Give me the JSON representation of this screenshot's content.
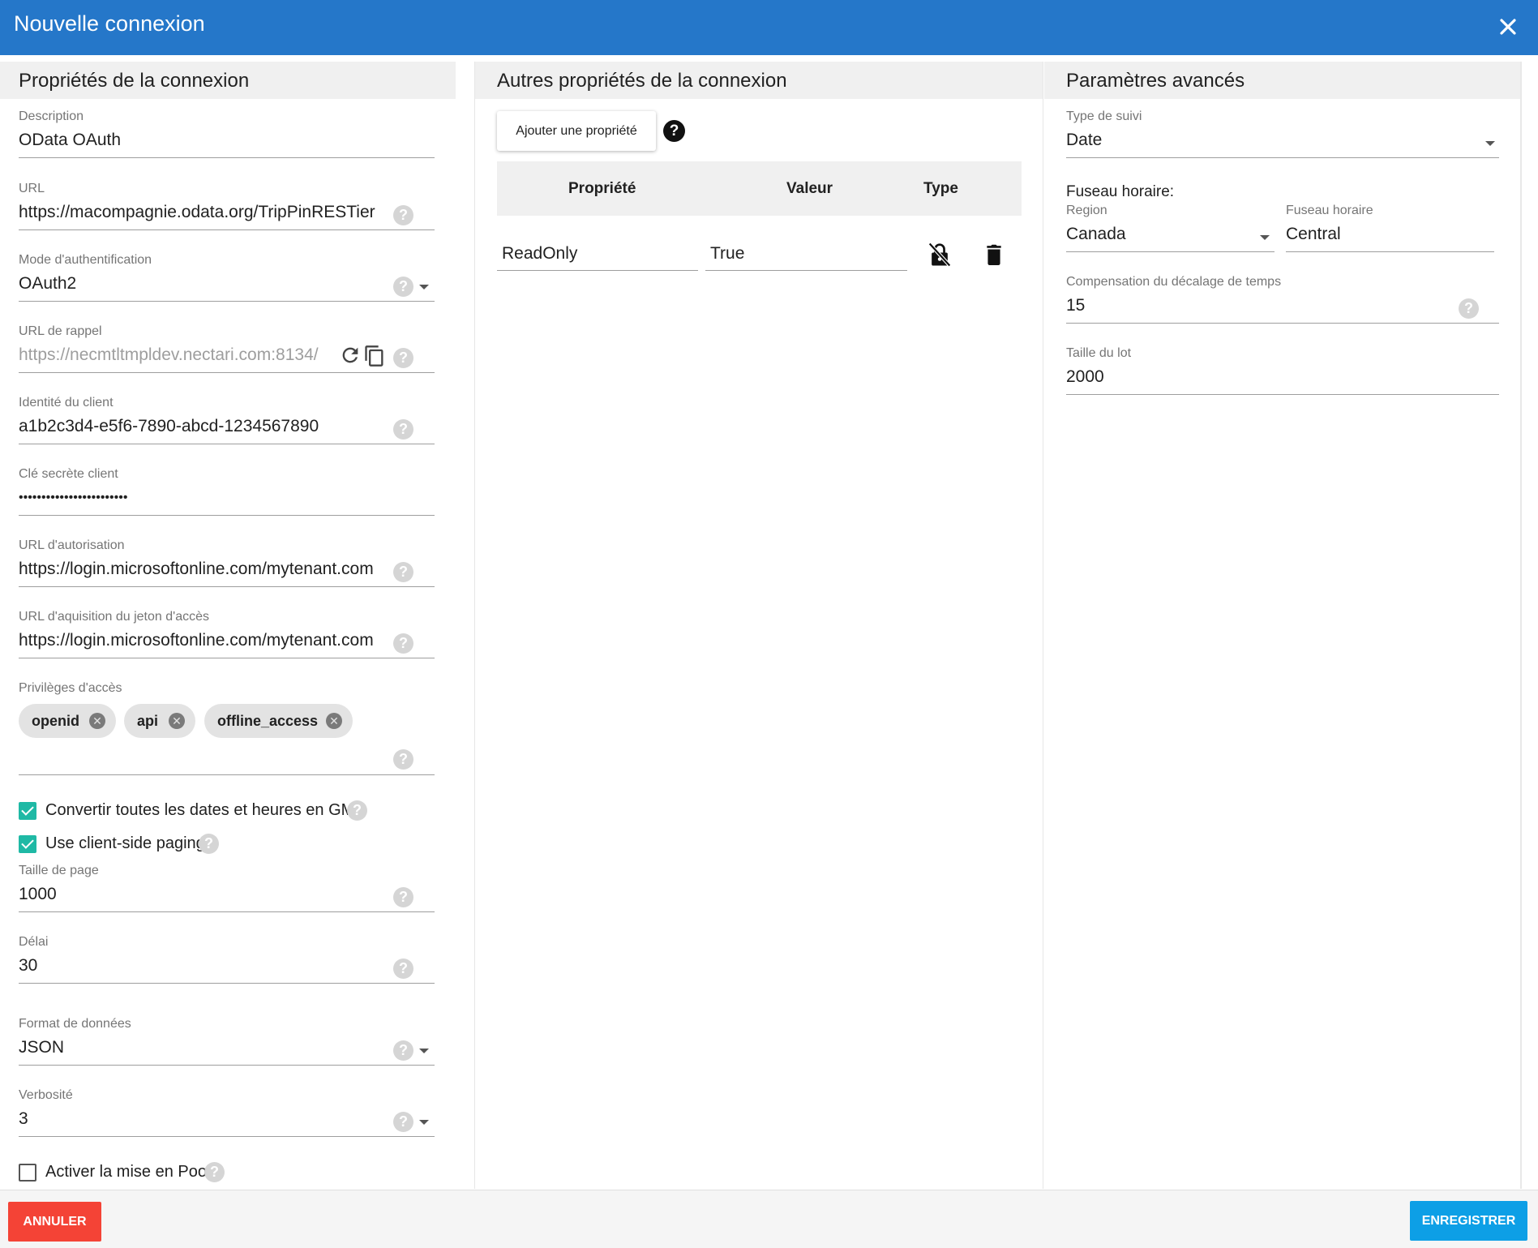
{
  "dialog": {
    "title": "Nouvelle connexion"
  },
  "left": {
    "heading": "Propriétés de la connexion",
    "description": {
      "label": "Description",
      "value": "OData OAuth"
    },
    "url": {
      "label": "URL",
      "value": "https://macompagnie.odata.org/TripPinRESTier"
    },
    "auth_mode": {
      "label": "Mode d'authentification",
      "value": "OAuth2"
    },
    "callback_url": {
      "label": "URL de rappel",
      "value": "https://necmtltmpldev.nectari.com:8134/"
    },
    "client_id": {
      "label": "Identité du client",
      "value": "a1b2c3d4-e5f6-7890-abcd-1234567890"
    },
    "client_secret": {
      "label": "Clé secrète client",
      "value": "••••••••••••••••••••••••"
    },
    "auth_url": {
      "label": "URL d'autorisation",
      "value": "https://login.microsoftonline.com/mytenant.com"
    },
    "token_url": {
      "label": "URL d'aquisition du jeton d'accès",
      "value": "https://login.microsoftonline.com/mytenant.com"
    },
    "scopes": {
      "label": "Privilèges d'accès",
      "chips": [
        "openid",
        "api",
        "offline_access"
      ]
    },
    "convert_gmt": {
      "label": "Convertir toutes les dates et heures en GMT",
      "checked": true
    },
    "client_paging": {
      "label": "Use client-side paging",
      "checked": true
    },
    "page_size": {
      "label": "Taille de page",
      "value": "1000"
    },
    "timeout": {
      "label": "Délai",
      "value": "30"
    },
    "data_format": {
      "label": "Format de données",
      "value": "JSON"
    },
    "verbosity": {
      "label": "Verbosité",
      "value": "3"
    },
    "pooling": {
      "label": "Activer la mise en Pool",
      "checked": false
    }
  },
  "middle": {
    "heading": "Autres propriétés de la connexion",
    "add_button": "Ajouter une propriété",
    "columns": [
      "Propriété",
      "Valeur",
      "Type"
    ],
    "rows": [
      {
        "property": "ReadOnly",
        "value": "True"
      }
    ]
  },
  "right": {
    "heading": "Paramètres avancés",
    "tracking_type": {
      "label": "Type de suivi",
      "value": "Date"
    },
    "timezone": {
      "label": "Fuseau horaire:",
      "region_label": "Region",
      "region_value": "Canada",
      "zone_label": "Fuseau horaire",
      "zone_value": "Central"
    },
    "time_offset": {
      "label": "Compensation du décalage de temps",
      "value": "15"
    },
    "batch_size": {
      "label": "Taille du lot",
      "value": "2000"
    }
  },
  "footer": {
    "cancel": "ANNULER",
    "save": "ENREGISTRER"
  },
  "colors": {
    "header": "#2577c9",
    "checkbox": "#1fb9a5",
    "cancel": "#f44336",
    "save": "#0d9fe6"
  }
}
